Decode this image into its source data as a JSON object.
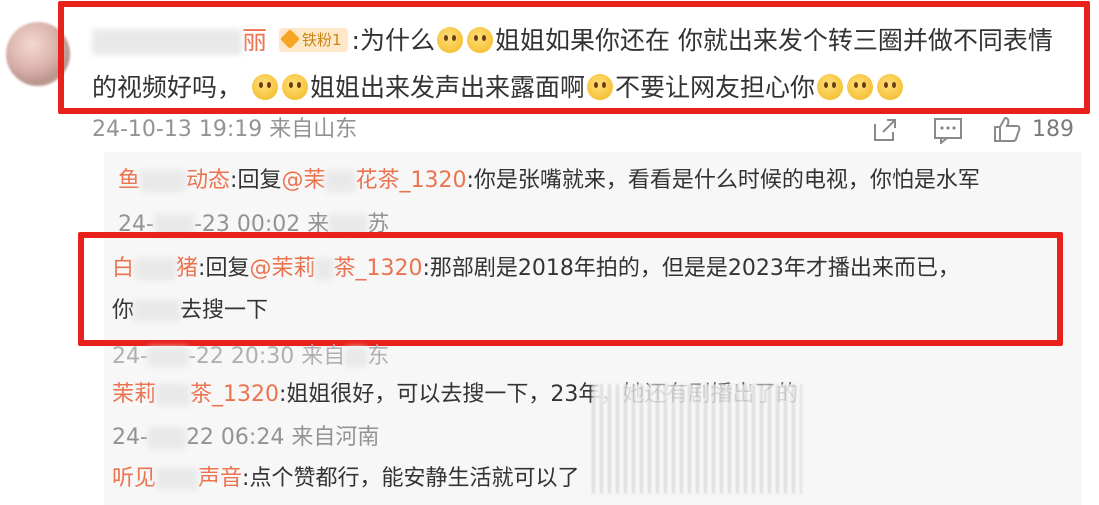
{
  "comment": {
    "author_suffix": "丽",
    "fan_badge": "铁粉1",
    "line1_text_a": ":为什么",
    "line1_text_b": "姐姐如果你还在 你就出来发个转三圈并做不同表情",
    "line2_text_a": "的视频好吗，",
    "line2_text_b": "姐姐出来发声出来露面啊",
    "line2_text_c": "不要让网友担心你",
    "timestamp": "24-10-13 19:19 来自山东",
    "like_count": "189"
  },
  "replies": [
    {
      "name_a": "鱼",
      "name_b": "动态",
      "reply_label": ":回复",
      "mention_a": "@茉",
      "mention_b": "花茶_1320",
      "text": ":你是张嘴就来，看看是什么时候的电视，你怕是水军",
      "time_a": "24-",
      "time_b": "-23 00:02 来",
      "time_c": "苏"
    },
    {
      "name_a": "白",
      "name_b": "猪",
      "reply_label": ":回复",
      "mention_a": "@茉莉",
      "mention_b": "茶_1320",
      "text": ":那部剧是2018年拍的，但是是2023年才播出来而已，",
      "line2_a": "你",
      "line2_b": "去搜一下",
      "time_a": "24-",
      "time_b": "-22 20:30 来自",
      "time_c": "东"
    },
    {
      "name_a": "茉莉",
      "name_b": "茶_1320",
      "text": ":姐姐很好，可以去搜一下，23年，她还有剧播出了的",
      "time_a": "24-",
      "time_b": "22 06:24 来自河南"
    },
    {
      "name_a": "听见",
      "name_b": "声音",
      "text": ":点个赞都行，能安静生活就可以了"
    }
  ],
  "colors": {
    "highlight_border": "#e8211b",
    "name": "#eb7350",
    "meta": "#939393"
  },
  "icons": [
    "share-icon",
    "comment-icon",
    "thumbs-up-icon",
    "smile-emoji-icon",
    "fan-badge-icon"
  ]
}
